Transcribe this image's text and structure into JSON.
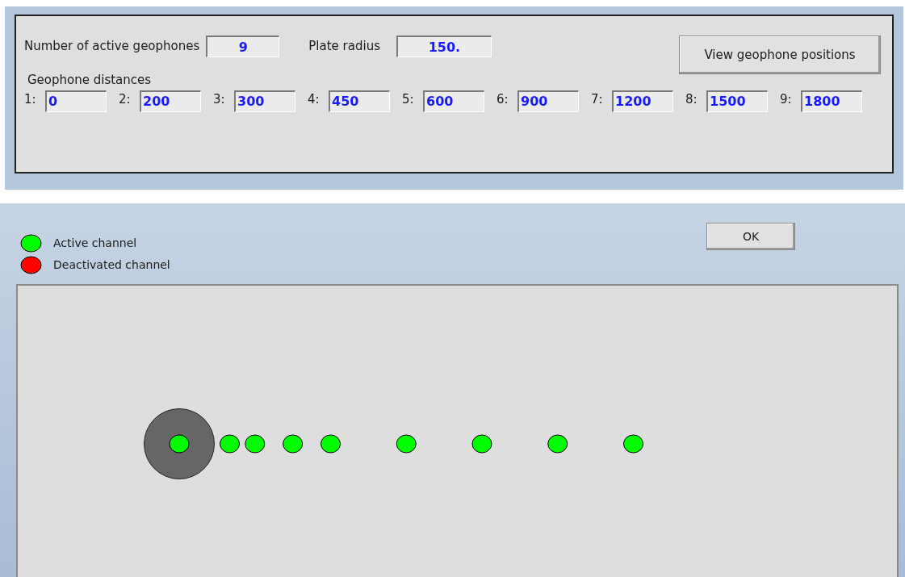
{
  "settings": {
    "active_count_label": "Number of active geophones",
    "active_count": "9",
    "plate_radius_label": "Plate radius",
    "plate_radius": "150.",
    "view_button": "View geophone positions",
    "distances_label": "Geophone distances",
    "distances": [
      {
        "index": "1:",
        "value": "0"
      },
      {
        "index": "2:",
        "value": "200"
      },
      {
        "index": "3:",
        "value": "300"
      },
      {
        "index": "4:",
        "value": "450"
      },
      {
        "index": "5:",
        "value": "600"
      },
      {
        "index": "6:",
        "value": "900"
      },
      {
        "index": "7:",
        "value": "1200"
      },
      {
        "index": "8:",
        "value": "1500"
      },
      {
        "index": "9:",
        "value": "1800"
      }
    ]
  },
  "positions_window": {
    "legend": [
      {
        "label": "Active channel",
        "color": "#00ff00"
      },
      {
        "label": "Deactivated channel",
        "color": "#ff0000"
      }
    ],
    "ok_button": "OK",
    "geophones": [
      {
        "active": true
      },
      {
        "active": true
      },
      {
        "active": true
      },
      {
        "active": true
      },
      {
        "active": true
      },
      {
        "active": true
      },
      {
        "active": true
      },
      {
        "active": true
      },
      {
        "active": true
      }
    ]
  }
}
